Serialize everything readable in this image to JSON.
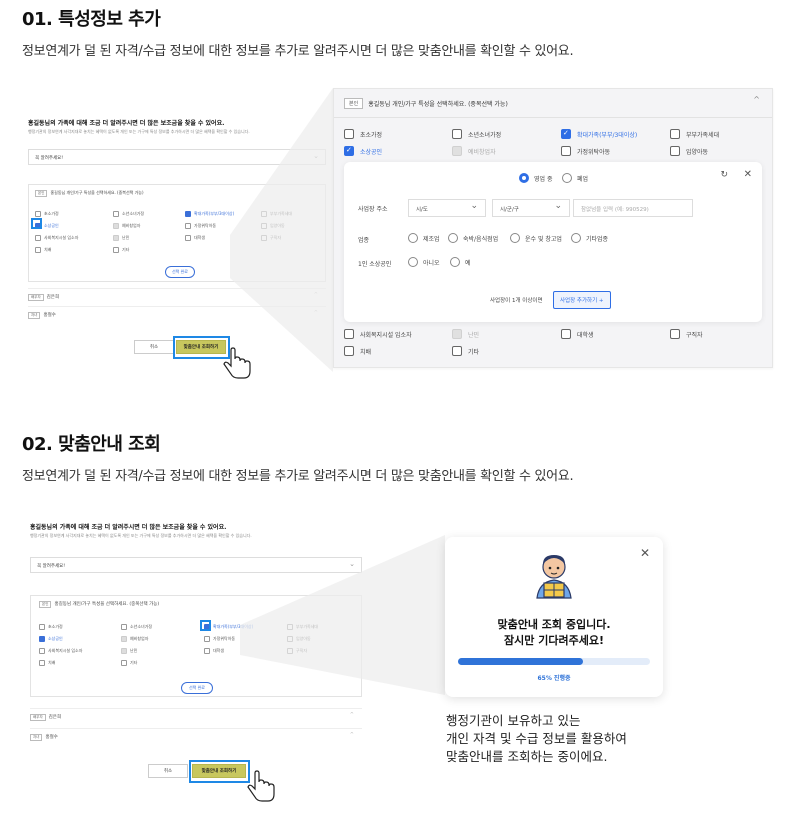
{
  "section1": {
    "title": "01. 특성정보 추가",
    "desc": "정보연계가 덜 된 자격/수급 정보에 대한 정보를 추가로 알려주시면 더 많은 맞춤안내를 확인할 수 있어요."
  },
  "section2": {
    "title": "02. 맞춤안내 조회",
    "desc": "정보연계가 덜 된 자격/수급 정보에 대한 정보를 추가로 알려주시면 더 많은 맞춤안내를 확인할 수 있어요."
  },
  "mini": {
    "heading": "홍길동님의 가족에 대해 조금 더 알려주시면 더 많은 보조금을 찾을 수 있어요.",
    "subtext": "행정기관의 정보연계 사각지대로 놓치는 혜택이 없도록 개인 또는 가구에 특성 정보를 추가하시면 더 많은 혜택을 확인할 수 있습니다.",
    "select_placeholder": "꼭 알려주세요!",
    "group_chip": "본인",
    "group_title": "홍길동님 개인/가구 특성을 선택하세요. (중복선택 가능)",
    "select_done": "선택 완료",
    "members": [
      {
        "chip": "배우자",
        "name": "김은희"
      },
      {
        "chip": "자녀",
        "name": "홍철수"
      }
    ],
    "cancel": "취소",
    "submit": "맞춤안내 조회하기"
  },
  "panel": {
    "chip": "본인",
    "title": "홍길동님 개인/가구 특성을 선택하세요. (중복선택 가능)",
    "row1": [
      "초소가정",
      "소년소녀가정",
      "확대가족(부부/3대이상)",
      "부부가족세대"
    ],
    "row2": [
      "소상공인",
      "예비창업자",
      "가정위탁아동",
      "입양아동"
    ],
    "status_on": "영업 중",
    "status_off": "폐업",
    "addr_label": "사업장 주소",
    "sido": "시/도",
    "sigungu": "시/군/구",
    "addr_placeholder": "참없넘을 입력 (예: 990529)",
    "biz_label": "업종",
    "biz_types": [
      "제조업",
      "숙박/음식점업",
      "운수 및 창고업",
      "기타업종"
    ],
    "solo_label": "1인 소상공인",
    "solo_opts": [
      "아니오",
      "예"
    ],
    "add_hint": "사업장이 1개 이상이면",
    "add_btn": "사업장 추가하기 +",
    "row3": [
      "사회복지시설 입소자",
      "난민",
      "대학생",
      "구직자"
    ],
    "row4": [
      "치배",
      "기타"
    ]
  },
  "modal": {
    "title_line1": "맞춤안내 조회 중입니다.",
    "title_line2": "잠시만 기다려주세요!",
    "progress": 0.65,
    "progress_label": "65% 진행중"
  },
  "caption": {
    "line1": "행정기관이 보유하고 있는",
    "line2": "개인 자격 및 수급 정보를 활용하여",
    "line3": "맞춤안내를 조회하는 중이에요."
  },
  "colors": {
    "accent": "#2f6ee5",
    "highlight": "#1e88e5",
    "submit": "#c8c75e"
  }
}
